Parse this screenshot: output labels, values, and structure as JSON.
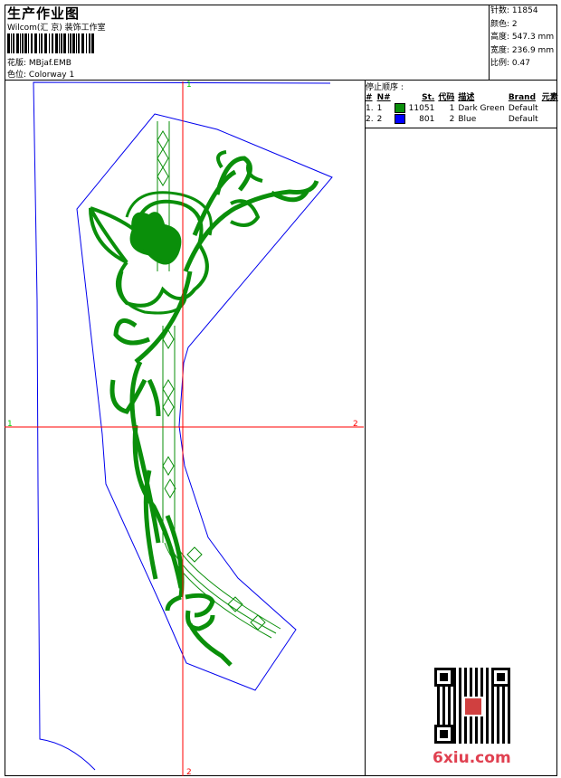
{
  "header": {
    "title": "生产作业图",
    "company": "Wilcom(汇 京) 装饰工作室",
    "design_label": "花版:",
    "design_value": "MBjaf.EMB",
    "colorway_label": "色位:",
    "colorway_value": "Colorway 1"
  },
  "info": {
    "stitches_label": "针数:",
    "stitches": "11854",
    "colors_label": "颜色:",
    "colors": "2",
    "height_label": "高度:",
    "height": "547.3 mm",
    "width_label": "宽度:",
    "width": "236.9 mm",
    "scale_label": "比例:",
    "scale": "0.47"
  },
  "stop_sequence": {
    "title": "停止顺序 :",
    "columns": [
      "#",
      "N#",
      "St.",
      "代码",
      "描述",
      "Brand",
      "元素"
    ],
    "rows": [
      {
        "idx": "1.",
        "n": "1",
        "color": "#0a8f0a",
        "st": "11051",
        "code": "1",
        "desc": "Dark Green",
        "brand": "Default"
      },
      {
        "idx": "2.",
        "n": "2",
        "color": "#0000ff",
        "st": "801",
        "code": "2",
        "desc": "Blue",
        "brand": "Default"
      }
    ]
  },
  "axes": {
    "top": "1",
    "bottom": "2",
    "left": "1",
    "right": "2"
  },
  "colors": {
    "thread_green": "#0a8f0a",
    "outline_blue": "#0000ee",
    "axis_red": "#ff0000"
  },
  "watermark": {
    "text": "6xiu.com"
  }
}
